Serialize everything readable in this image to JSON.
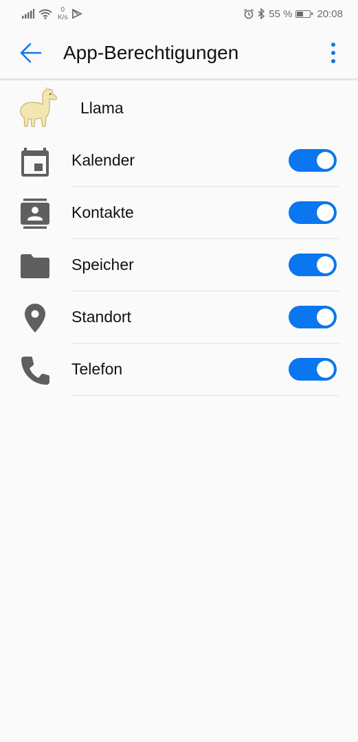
{
  "status_bar": {
    "net_speed_value": "0",
    "net_speed_unit": "K/s",
    "battery_text": "55 %",
    "battery_level": 0.55,
    "time": "20:08"
  },
  "header": {
    "title": "App-Berechtigungen"
  },
  "app": {
    "name": "Llama"
  },
  "permissions": [
    {
      "label": "Kalender",
      "icon": "calendar-icon",
      "enabled": true
    },
    {
      "label": "Kontakte",
      "icon": "contacts-icon",
      "enabled": true
    },
    {
      "label": "Speicher",
      "icon": "folder-icon",
      "enabled": true
    },
    {
      "label": "Standort",
      "icon": "location-pin-icon",
      "enabled": true
    },
    {
      "label": "Telefon",
      "icon": "phone-icon",
      "enabled": true
    }
  ],
  "colors": {
    "accent": "#0a76ef",
    "icon_gray": "#5f5f5f",
    "background": "#fafafa"
  }
}
